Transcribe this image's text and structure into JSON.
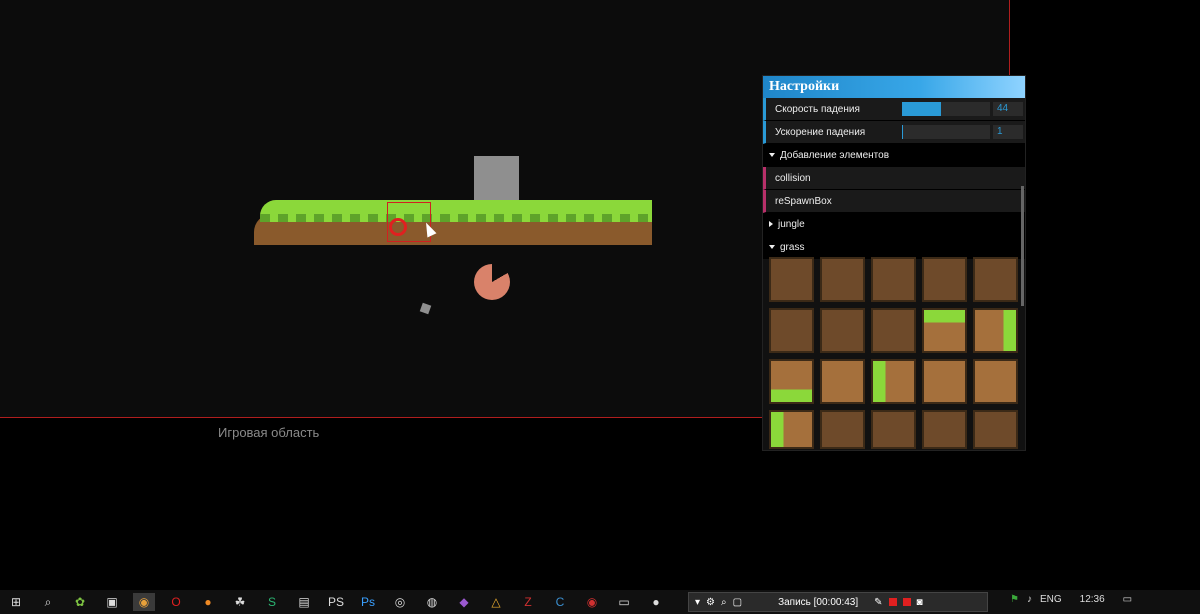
{
  "game_area": {
    "label": "Игровая область"
  },
  "settings": {
    "title": "Настройки",
    "fall_speed": {
      "label": "Скорость падения",
      "value": "44",
      "fill_fraction": 0.44
    },
    "fall_accel": {
      "label": "Ускорение падения",
      "value": "1",
      "fill_fraction": 0.01
    },
    "add_elements": {
      "label": "Добавление элементов"
    },
    "collision": {
      "label": "collision"
    },
    "respawn": {
      "label": "reSpawnBox"
    },
    "jungle": {
      "label": "jungle"
    },
    "grass": {
      "label": "grass"
    }
  },
  "taskbar": {
    "record_label": "Запись [00:00:43]",
    "language": "ENG",
    "time": "12:36"
  },
  "colors": {
    "accent": "#2a9ad6",
    "game_border": "#b01e1e",
    "grass": "#8bd83a",
    "dirt": "#8a5a2c"
  }
}
